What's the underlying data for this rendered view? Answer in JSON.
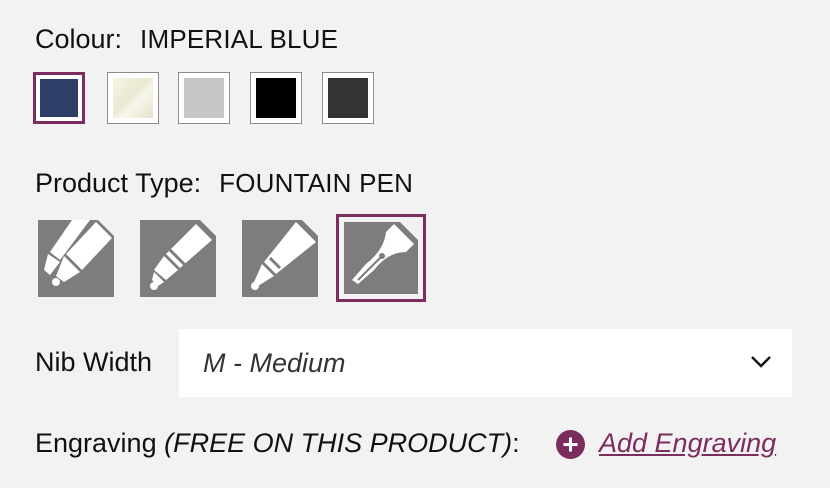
{
  "colour": {
    "label": "Colour:",
    "selected": "IMPERIAL BLUE",
    "swatches": [
      {
        "name": "imperial-blue",
        "color": "#2f3e66",
        "selected": true
      },
      {
        "name": "ivory",
        "color": "#efeddc",
        "selected": false
      },
      {
        "name": "silver",
        "color": "#c6c6c6",
        "selected": false
      },
      {
        "name": "black",
        "color": "#000000",
        "selected": false
      },
      {
        "name": "charcoal",
        "color": "#333333",
        "selected": false
      }
    ]
  },
  "product_type": {
    "label": "Product Type:",
    "selected": "FOUNTAIN PEN",
    "options": [
      {
        "icon": "ballpoint-pen-icon",
        "selected": false
      },
      {
        "icon": "rollerball-pen-icon",
        "selected": false
      },
      {
        "icon": "fineliner-pen-icon",
        "selected": false
      },
      {
        "icon": "fountain-pen-nib-icon",
        "selected": true
      }
    ]
  },
  "nib_width": {
    "label": "Nib Width",
    "value": "M - Medium",
    "icon": "chevron-down-icon"
  },
  "engraving": {
    "label": "Engraving",
    "note": "(FREE ON THIS PRODUCT)",
    "colon": ":",
    "add_label": "Add Engraving",
    "icon": "plus-circle-icon"
  },
  "colors": {
    "accent": "#7b2d5e",
    "tile": "#7d7d7f",
    "background": "#f2f2f2"
  }
}
